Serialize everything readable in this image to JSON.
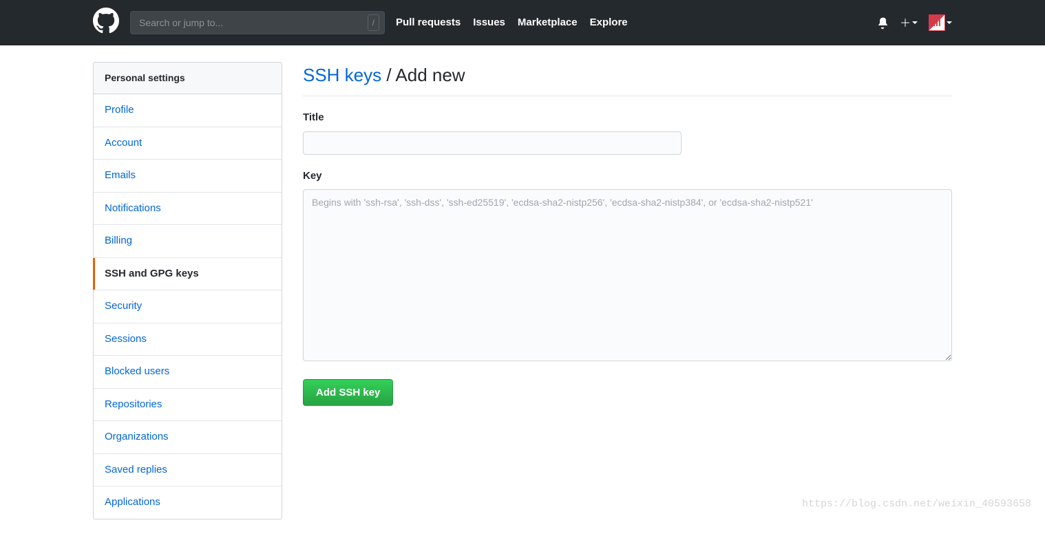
{
  "header": {
    "search_placeholder": "Search or jump to...",
    "search_key": "/",
    "nav": [
      "Pull requests",
      "Issues",
      "Marketplace",
      "Explore"
    ]
  },
  "sidebar": {
    "header": "Personal settings",
    "items": [
      {
        "label": "Profile",
        "active": false
      },
      {
        "label": "Account",
        "active": false
      },
      {
        "label": "Emails",
        "active": false
      },
      {
        "label": "Notifications",
        "active": false
      },
      {
        "label": "Billing",
        "active": false
      },
      {
        "label": "SSH and GPG keys",
        "active": true
      },
      {
        "label": "Security",
        "active": false
      },
      {
        "label": "Sessions",
        "active": false
      },
      {
        "label": "Blocked users",
        "active": false
      },
      {
        "label": "Repositories",
        "active": false
      },
      {
        "label": "Organizations",
        "active": false
      },
      {
        "label": "Saved replies",
        "active": false
      },
      {
        "label": "Applications",
        "active": false
      }
    ]
  },
  "main": {
    "title_link": "SSH keys",
    "title_sep": " / ",
    "title_rest": "Add new",
    "form": {
      "title_label": "Title",
      "title_value": "",
      "key_label": "Key",
      "key_value": "",
      "key_placeholder": "Begins with 'ssh-rsa', 'ssh-dss', 'ssh-ed25519', 'ecdsa-sha2-nistp256', 'ecdsa-sha2-nistp384', or 'ecdsa-sha2-nistp521'",
      "submit_label": "Add SSH key"
    }
  },
  "watermark": "https://blog.csdn.net/weixin_40593658"
}
